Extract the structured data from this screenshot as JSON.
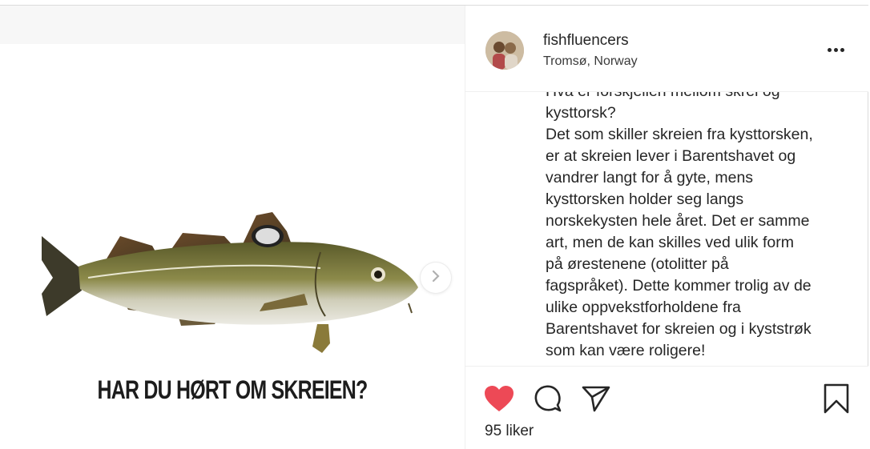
{
  "post": {
    "media": {
      "caption_text": "HAR DU HØRT OM SKREIEN?",
      "next_icon": "chevron-right-icon"
    },
    "header": {
      "username": "fishfluencers",
      "location": "Tromsø, Norway"
    },
    "caption": "Hva er forskjellen mellom skrei og\nkysttorsk?\nDet som skiller skreien fra kysttorsken,\ner at skreien lever i Barentshavet og\nvandrer langt for å gyte, mens\nkysttorsken holder seg langs\nnorskekysten hele året. Det er samme\nart, men de kan skilles ved ulik form\npå ørestenene (otolitter på\nfagspråket). Dette kommer trolig av de\nulike oppvekstforholdene fra\nBarentshavet for skreien og i kyststrøk\nsom kan være roligere!",
    "actions": {
      "like_icon": "heart-filled-icon",
      "comment_icon": "comment-icon",
      "share_icon": "paper-plane-icon",
      "save_icon": "bookmark-icon",
      "like_color": "#ed4956"
    },
    "likes_text": "95 liker"
  }
}
